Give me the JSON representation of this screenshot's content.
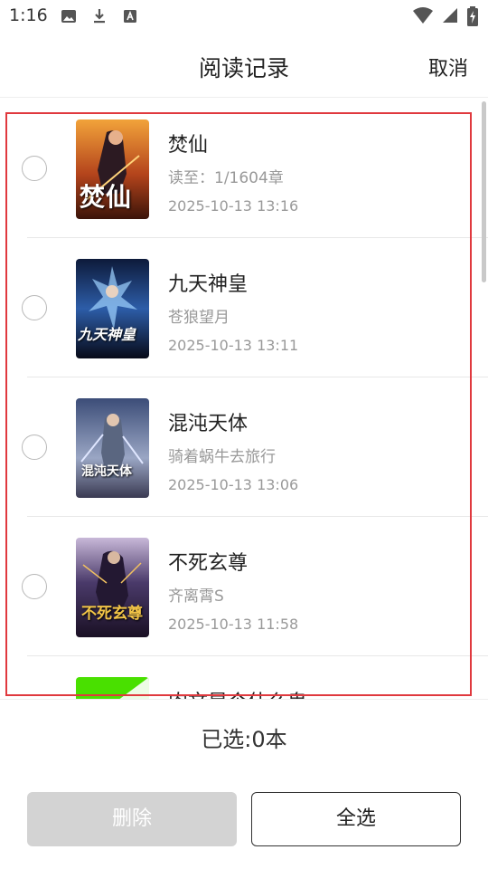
{
  "status_bar": {
    "time": "1:16",
    "icons": [
      "image-icon",
      "download-icon",
      "font-icon",
      "wifi-icon",
      "signal-icon",
      "battery-charging-icon"
    ]
  },
  "header": {
    "title": "阅读记录",
    "cancel_label": "取消"
  },
  "books": [
    {
      "title": "焚仙",
      "subtitle": "读至：1/1604章",
      "time": "2025-10-13 13:16",
      "cover_text": "焚仙"
    },
    {
      "title": "九天神皇",
      "subtitle": "苍狼望月",
      "time": "2025-10-13 13:11",
      "cover_text": "九天神皇"
    },
    {
      "title": "混沌天体",
      "subtitle": "骑着蜗牛去旅行",
      "time": "2025-10-13 13:06",
      "cover_text": "混沌天体"
    },
    {
      "title": "不死玄尊",
      "subtitle": "齐离霄S",
      "time": "2025-10-13 11:58",
      "cover_text": "不死玄尊"
    },
    {
      "title": "肉文是个什么鬼",
      "subtitle": "",
      "time": "",
      "cover_text": ""
    }
  ],
  "footer": {
    "selected_label": "已选:0本",
    "delete_label": "删除",
    "select_all_label": "全选"
  },
  "colors": {
    "highlight_border": "#e0393e",
    "delete_disabled": "#d3d3d3"
  }
}
